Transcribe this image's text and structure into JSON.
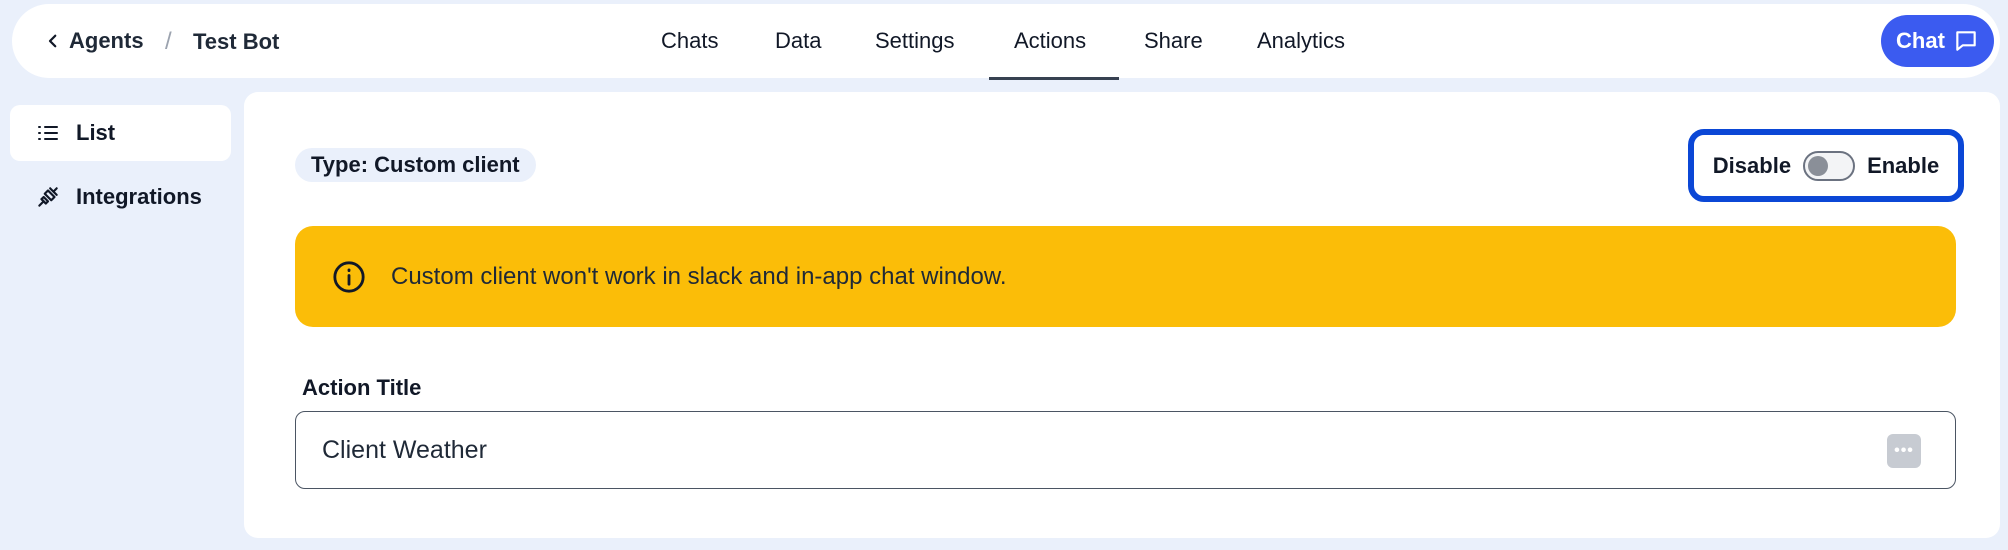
{
  "header": {
    "breadcrumb": {
      "parent": "Agents",
      "separator": "/",
      "current": "Test Bot"
    },
    "tabs": [
      {
        "label": "Chats"
      },
      {
        "label": "Data"
      },
      {
        "label": "Settings"
      },
      {
        "label": "Actions",
        "active": true
      },
      {
        "label": "Share"
      },
      {
        "label": "Analytics"
      }
    ],
    "chat_button": {
      "label": "Chat",
      "icon": "message-square-icon"
    }
  },
  "sidebar": {
    "items": [
      {
        "label": "List",
        "icon": "list-icon",
        "active": true
      },
      {
        "label": "Integrations",
        "icon": "plug-icon",
        "active": false
      }
    ]
  },
  "main": {
    "type_badge": "Type: Custom client",
    "toggle": {
      "off_label": "Disable",
      "on_label": "Enable",
      "enabled": false
    },
    "alert": {
      "icon": "info-icon",
      "message": "Custom client won't work in slack and in-app chat window."
    },
    "action_title": {
      "label": "Action Title",
      "value": "Client Weather",
      "more_icon": "more-horizontal-icon"
    }
  },
  "colors": {
    "background": "#eaf0fb",
    "accent": "#3b5bf0",
    "highlight_border": "#0b47d6",
    "warning": "#fbbd08"
  }
}
